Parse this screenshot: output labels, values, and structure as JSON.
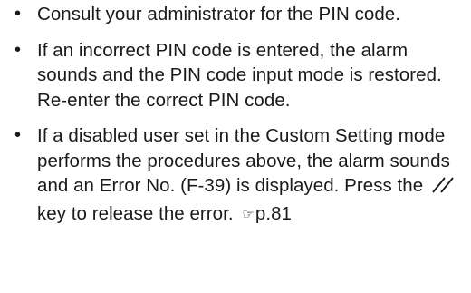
{
  "notes": [
    {
      "bullet": "•",
      "text": "Consult your administrator for the PIN code."
    },
    {
      "bullet": "•",
      "text": "If an incorrect PIN code is entered, the alarm sounds and the PIN code input mode is restored. Re-enter the correct PIN code."
    },
    {
      "bullet": "•",
      "text_before_key": "If a disabled user set in the Custom Setting mode performs the procedures above, the alarm sounds and an Error No. (F-39) is displayed. Press the",
      "key_icon": "clear-stop-key-icon",
      "text_after_key": "key to release the error.",
      "ref_icon": "pointing-hand-icon",
      "ref_glyph": "☞",
      "ref_page": "p.81"
    }
  ]
}
